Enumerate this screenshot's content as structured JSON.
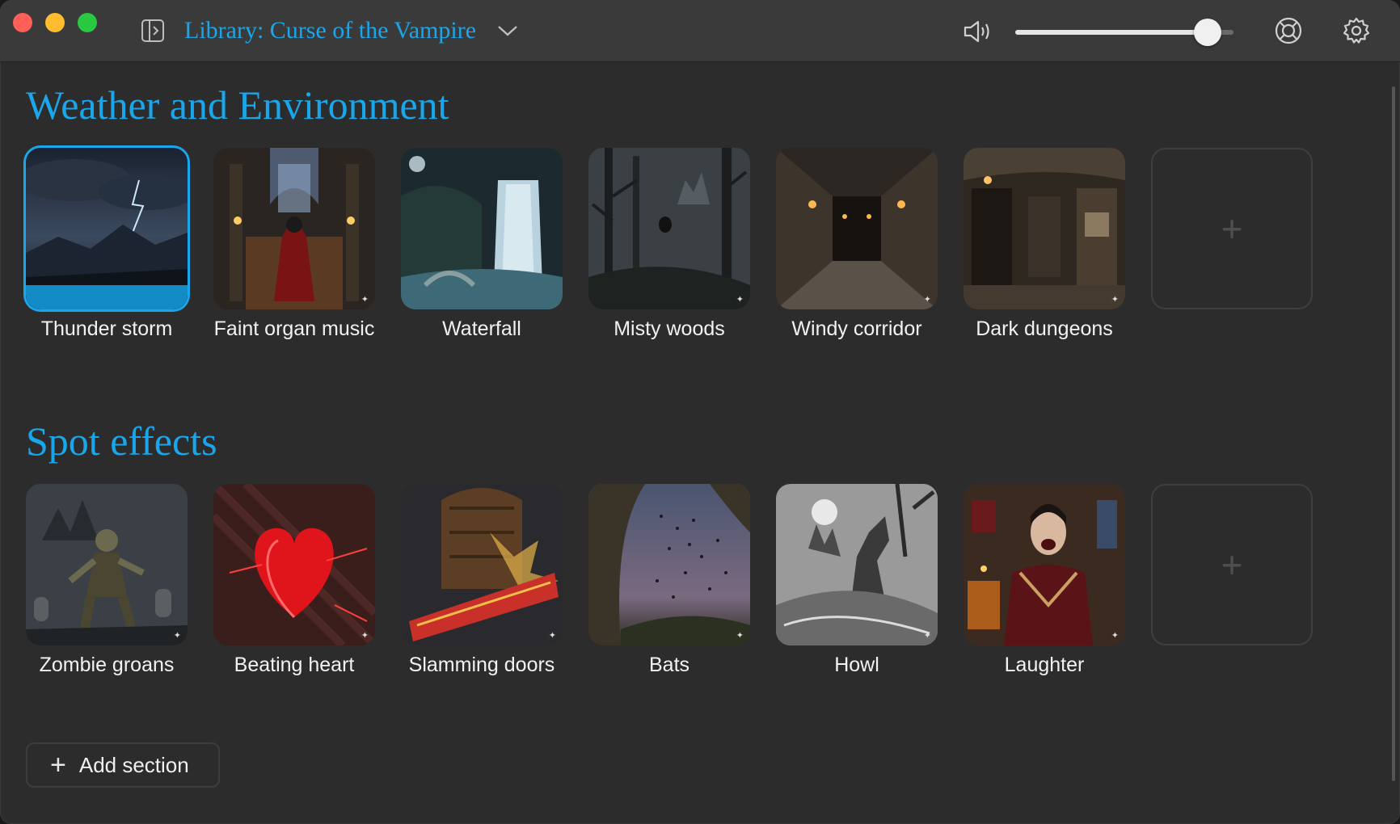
{
  "app": {
    "library_title": "Library: Curse of the Vampire",
    "volume_level": 0.88,
    "accent_color": "#1aa6ea",
    "icons": [
      "sidebar-toggle-icon",
      "chevron-down-icon",
      "speaker-icon",
      "lifebuoy-icon",
      "gear-icon"
    ]
  },
  "sections": [
    {
      "title": "Weather and Environment",
      "tiles": [
        {
          "label": "Thunder storm",
          "selected": true,
          "playback_progress": 1.0
        },
        {
          "label": "Faint organ music",
          "selected": false
        },
        {
          "label": "Waterfall",
          "selected": false
        },
        {
          "label": "Misty woods",
          "selected": false
        },
        {
          "label": "Windy corridor",
          "selected": false
        },
        {
          "label": "Dark dungeons",
          "selected": false
        }
      ],
      "add_tile_symbol": "+"
    },
    {
      "title": "Spot effects",
      "tiles": [
        {
          "label": "Zombie groans",
          "selected": false
        },
        {
          "label": "Beating heart",
          "selected": false
        },
        {
          "label": "Slamming doors",
          "selected": false
        },
        {
          "label": "Bats",
          "selected": false
        },
        {
          "label": "Howl",
          "selected": false
        },
        {
          "label": "Laughter",
          "selected": false
        }
      ],
      "add_tile_symbol": "+"
    }
  ],
  "add_section": {
    "symbol": "+",
    "label": "Add section"
  }
}
